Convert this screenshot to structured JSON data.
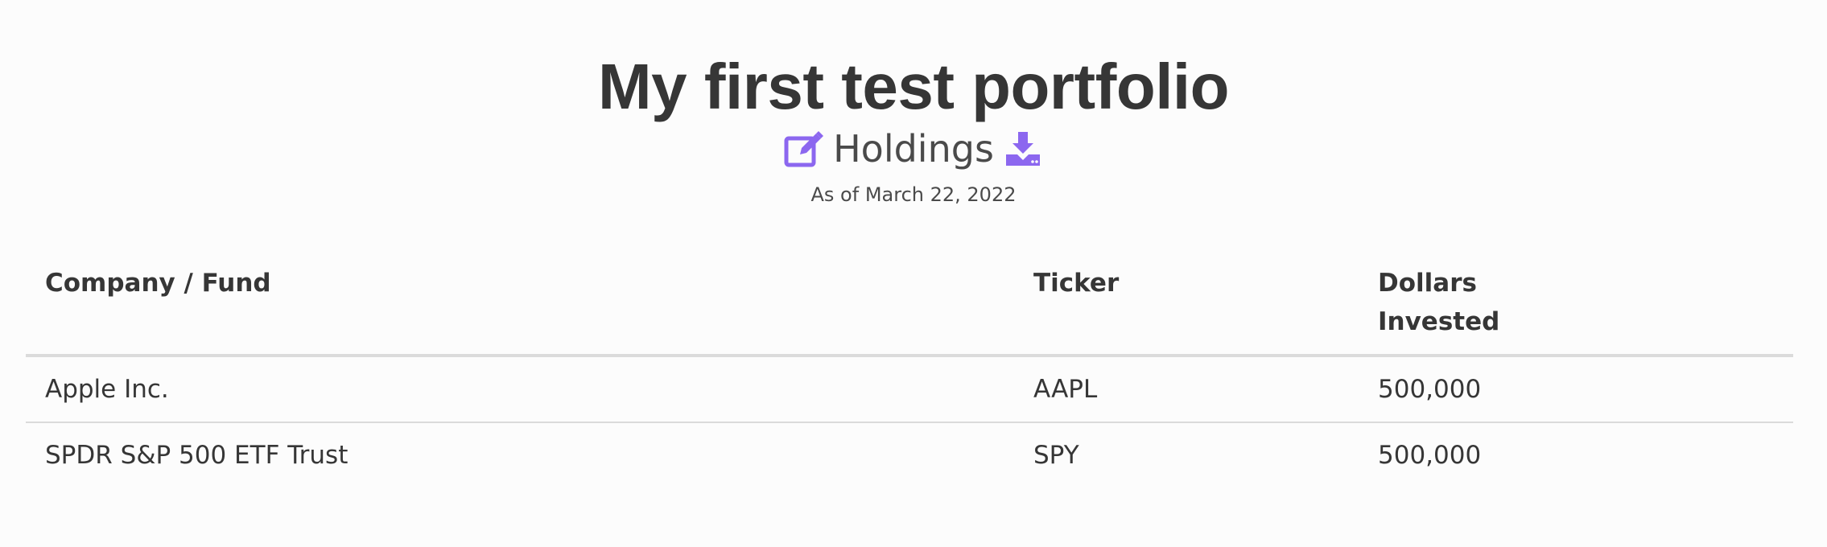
{
  "header": {
    "title": "My first test portfolio",
    "subtitle": "Holdings",
    "as_of": "As of March 22, 2022",
    "edit_icon": "edit-icon",
    "download_icon": "download-icon",
    "accent_color": "#8c67ef"
  },
  "table": {
    "columns": {
      "company": "Company / Fund",
      "ticker": "Ticker",
      "dollars": "Dollars Invested"
    },
    "rows": [
      {
        "company": "Apple Inc.",
        "ticker": "AAPL",
        "dollars": "500,000"
      },
      {
        "company": "SPDR S&P 500 ETF Trust",
        "ticker": "SPY",
        "dollars": "500,000"
      }
    ]
  }
}
